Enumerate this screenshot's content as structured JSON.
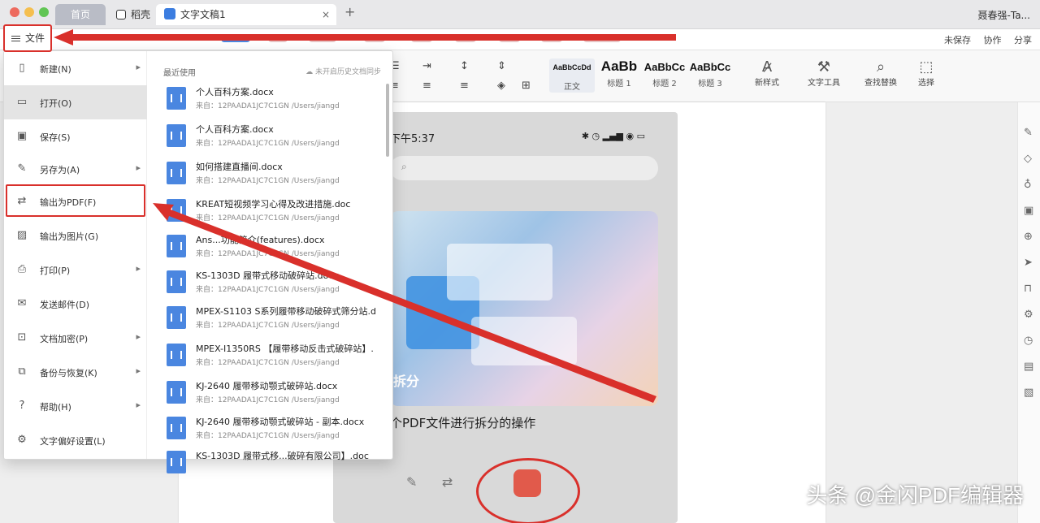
{
  "window": {
    "tabs": [
      {
        "label": "首页"
      },
      {
        "label": "稻壳"
      },
      {
        "label": "文字文稿1"
      }
    ],
    "user": "聂春强-Ta..."
  },
  "toolbar": {
    "file_label": "文件",
    "right_buttons": [
      "未保存",
      "协作",
      "分享"
    ]
  },
  "ribbon": {
    "styles": [
      {
        "sample": "AaBbCcDd",
        "name": "正文"
      },
      {
        "sample": "AaBb",
        "name": "标题 1"
      },
      {
        "sample": "AaBbCc",
        "name": "标题 2"
      },
      {
        "sample": "AaBbCc",
        "name": "标题 3"
      }
    ],
    "tools": [
      "新样式",
      "文字工具",
      "查找替换",
      "选择"
    ]
  },
  "file_menu": {
    "items": [
      {
        "label": "新建(N)",
        "arrow": true
      },
      {
        "label": "打开(O)",
        "arrow": false
      },
      {
        "label": "保存(S)",
        "arrow": false
      },
      {
        "label": "另存为(A)",
        "arrow": true
      },
      {
        "label": "输出为PDF(F)",
        "arrow": false
      },
      {
        "label": "输出为图片(G)",
        "arrow": false
      },
      {
        "label": "打印(P)",
        "arrow": true
      },
      {
        "label": "发送邮件(D)",
        "arrow": false
      },
      {
        "label": "文档加密(P)",
        "arrow": true
      },
      {
        "label": "备份与恢复(K)",
        "arrow": true
      },
      {
        "label": "帮助(H)",
        "arrow": true
      },
      {
        "label": "文字偏好设置(L)",
        "arrow": false
      }
    ],
    "recent_title": "最近使用",
    "sync_text": "未开启历史文档同步",
    "recent_files": [
      {
        "name": "个人百科方案.docx",
        "path": "来自：12PAADA1JC7C1GN /Users/jiangd"
      },
      {
        "name": "个人百科方案.docx",
        "path": "来自：12PAADA1JC7C1GN /Users/jiangd"
      },
      {
        "name": "如何搭建直播间.docx",
        "path": "来自：12PAADA1JC7C1GN /Users/jiangd"
      },
      {
        "name": "KREAT短视频学习心得及改进措施.doc",
        "path": "来自：12PAADA1JC7C1GN /Users/jiangd"
      },
      {
        "name": "Ans...功能简介(features).docx",
        "path": "来自：12PAADA1JC7C1GN /Users/jiangd"
      },
      {
        "name": "KS-1303D 履带式移动破碎站.docx",
        "path": "来自：12PAADA1JC7C1GN /Users/jiangd"
      },
      {
        "name": "MPEX-S1103 S系列履带移动破碎式筛分站.d",
        "path": "来自：12PAADA1JC7C1GN /Users/jiangd"
      },
      {
        "name": "MPEX-I1350RS 【履带移动反击式破碎站】.",
        "path": "来自：12PAADA1JC7C1GN /Users/jiangd"
      },
      {
        "name": "KJ-2640 履带移动颚式破碎站.docx",
        "path": "来自：12PAADA1JC7C1GN /Users/jiangd"
      },
      {
        "name": "KJ-2640 履带移动颚式破碎站 - 副本.docx",
        "path": "来自：12PAADA1JC7C1GN /Users/jiangd"
      },
      {
        "name": "KS-1303D 履带式移...破碎有限公司】.doc",
        "path": ""
      }
    ]
  },
  "document": {
    "phone_time": "下午5:37",
    "banner_tag": "拆分",
    "caption": "个PDF文件进行拆分的操作"
  },
  "watermark": "头条 @金闪PDF编辑器",
  "colors": {
    "annotation_red": "#d9302b",
    "file_icon_blue": "#4a86e0"
  }
}
